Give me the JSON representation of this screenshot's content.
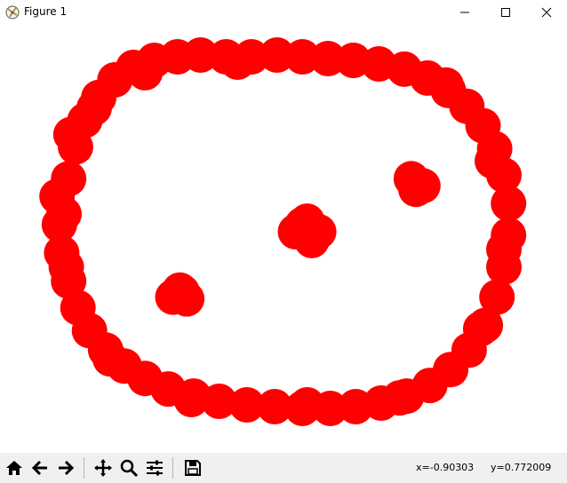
{
  "window": {
    "title": "Figure 1"
  },
  "toolbar": {
    "buttons": [
      "home-icon",
      "back-arrow-icon",
      "forward-arrow-icon",
      "pan-icon",
      "zoom-icon",
      "configure-subplots-icon",
      "save-icon"
    ],
    "coord_x": "x=-0.90303",
    "coord_y": "y=0.772009"
  },
  "colors": {
    "marker": "#ff0000",
    "toolbar_bg": "#f0f0f0"
  },
  "chart_data": {
    "type": "scatter",
    "axes_visible": false,
    "grid": false,
    "marker_color": "#ff0000",
    "series": [
      {
        "x": [
          -0.95,
          -0.93,
          -0.9,
          -0.86,
          -0.8,
          -0.73,
          -0.65,
          -0.56,
          -0.46,
          -0.36,
          -0.25,
          -0.14,
          -0.03,
          0.08,
          0.19,
          0.3,
          0.41,
          0.52,
          0.62,
          0.71,
          0.79,
          0.86,
          0.91,
          0.95,
          0.97,
          0.97,
          0.95,
          0.92,
          0.87,
          0.8,
          0.72,
          0.63,
          0.53,
          0.42,
          0.31,
          0.2,
          0.08,
          -0.04,
          -0.16,
          -0.28,
          -0.39,
          -0.5,
          -0.6,
          -0.69,
          -0.77,
          -0.84,
          -0.89,
          -0.93,
          -0.96,
          -0.97,
          -0.98,
          -0.92,
          -0.82,
          -0.6,
          -0.2,
          0.3,
          0.7,
          0.9,
          0.95,
          0.85,
          0.5,
          0.1,
          -0.4,
          -0.75,
          -0.94,
          0.1,
          0.15,
          0.05,
          0.12,
          0.08,
          0.55,
          0.6,
          0.57,
          -0.45,
          -0.42,
          -0.48,
          -0.44
        ],
        "y": [
          0.1,
          0.3,
          0.48,
          0.63,
          0.76,
          0.86,
          0.93,
          0.97,
          0.99,
          1.0,
          0.99,
          0.99,
          1.0,
          0.99,
          0.98,
          0.97,
          0.95,
          0.92,
          0.87,
          0.8,
          0.71,
          0.6,
          0.47,
          0.32,
          0.16,
          -0.02,
          -0.2,
          -0.37,
          -0.53,
          -0.67,
          -0.78,
          -0.87,
          -0.93,
          -0.97,
          -0.99,
          -1.0,
          -1.0,
          -0.99,
          -0.98,
          -0.96,
          -0.93,
          -0.89,
          -0.83,
          -0.76,
          -0.67,
          -0.56,
          -0.43,
          -0.28,
          -0.12,
          0.04,
          0.2,
          0.55,
          0.7,
          0.9,
          0.96,
          0.97,
          0.83,
          0.4,
          -0.1,
          -0.55,
          -0.94,
          -0.98,
          -0.95,
          -0.72,
          -0.2,
          0.06,
          0.0,
          0.0,
          -0.05,
          0.04,
          0.3,
          0.26,
          0.24,
          -0.33,
          -0.38,
          -0.37,
          -0.34
        ]
      }
    ]
  }
}
